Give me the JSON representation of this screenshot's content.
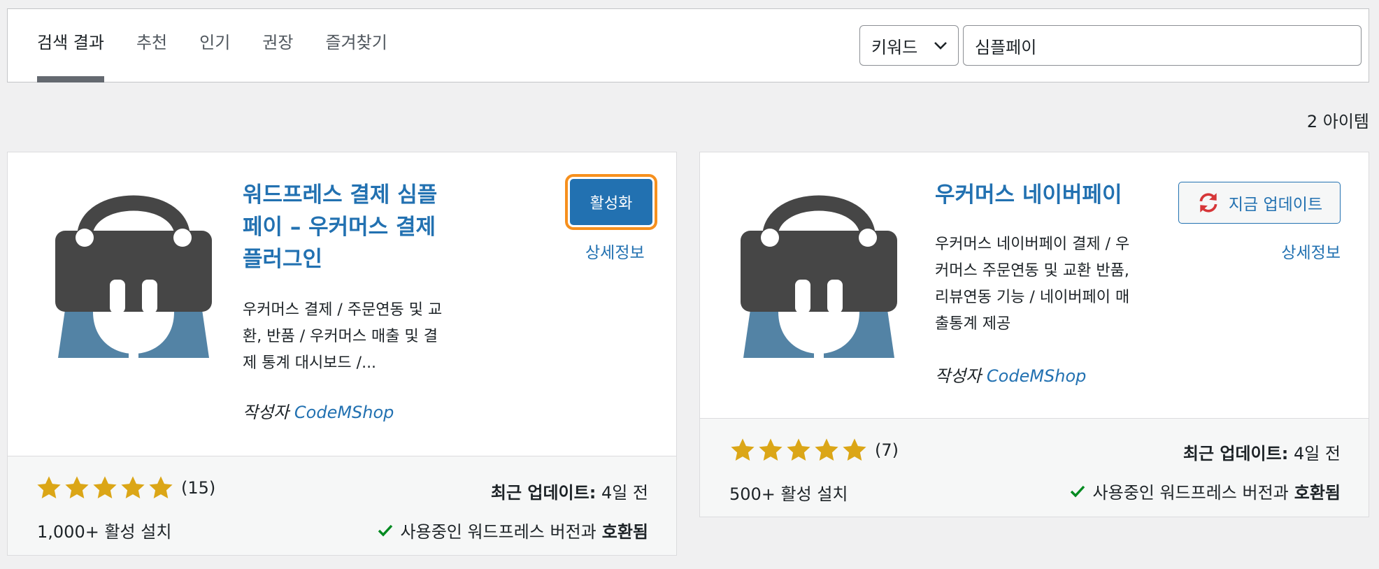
{
  "tabs": [
    {
      "label": "검색 결과"
    },
    {
      "label": "추천"
    },
    {
      "label": "인기"
    },
    {
      "label": "권장"
    },
    {
      "label": "즐겨찾기"
    }
  ],
  "search": {
    "type_label": "키워드",
    "value": "심플페이"
  },
  "result_count": "2 아이템",
  "colors": {
    "accent": "#2271b1",
    "focus_ring": "#f6901e",
    "star": "#dba617",
    "icon_dark": "#464646",
    "icon_blue": "#5383a5"
  },
  "cards": [
    {
      "title_lines": [
        "워드프레스 결제 심플",
        "페이 – 우커머스 결제",
        "플러그인"
      ],
      "description_lines": [
        "우커머스 결제 / 주문연동 및 교",
        "환, 반품 / 우커머스 매출 및 결",
        "제 통계 대시보드 /..."
      ],
      "author_prefix": "작성자",
      "author_name": "CodeMShop",
      "action_label": "활성화",
      "details_label": "상세정보",
      "rating_stars": 5,
      "rating_count": "(15)",
      "installs": "1,000+ 활성 설치",
      "last_updated_label": "최근 업데이트:",
      "last_updated_value": "4일 전",
      "compat_text": "사용중인 워드프레스 버전과",
      "compat_bold": "호환됨"
    },
    {
      "title_lines": [
        "우커머스 네이버페이"
      ],
      "description_lines": [
        "우커머스 네이버페이 결제 / 우",
        "커머스 주문연동 및 교환 반품,",
        "리뷰연동 기능 / 네이버페이 매",
        "출통계 제공"
      ],
      "author_prefix": "작성자",
      "author_name": "CodeMShop",
      "action_label": "지금 업데이트",
      "details_label": "상세정보",
      "rating_stars": 5,
      "rating_count": "(7)",
      "installs": "500+ 활성 설치",
      "last_updated_label": "최근 업데이트:",
      "last_updated_value": "4일 전",
      "compat_text": "사용중인 워드프레스 버전과",
      "compat_bold": "호환됨"
    }
  ]
}
